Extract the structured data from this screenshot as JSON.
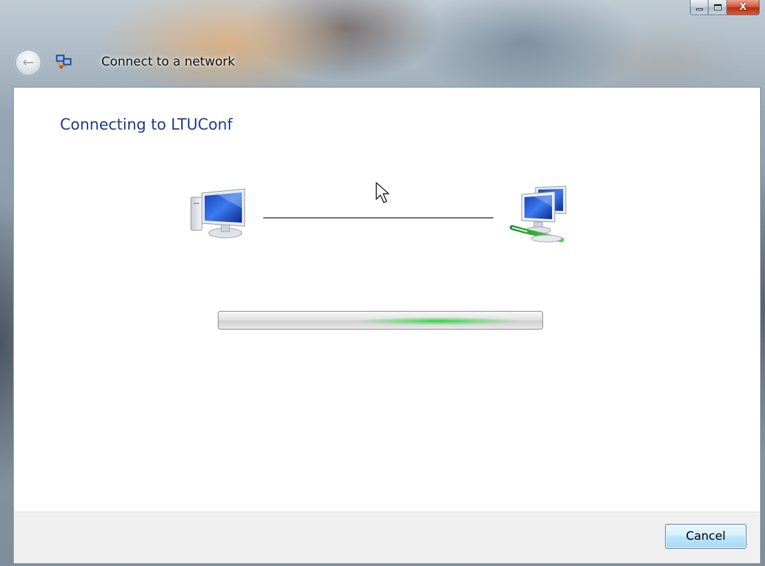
{
  "window": {
    "title": "Connect to a network",
    "caption_buttons": {
      "minimize_icon": "minimize-icon",
      "maximize_icon": "maximize-icon",
      "close_label": "X"
    },
    "back_icon": "back-arrow-icon",
    "title_icon": "network-connect-icon"
  },
  "main": {
    "heading": "Connecting to LTUConf",
    "left_icon": "computer-icon",
    "right_icon": "network-icon",
    "progress": {
      "state": "indeterminate",
      "accent_color": "#22cc44"
    }
  },
  "footer": {
    "cancel_label": "Cancel"
  },
  "colors": {
    "heading": "#1e3d8a",
    "button_border": "#3c7fb1"
  }
}
